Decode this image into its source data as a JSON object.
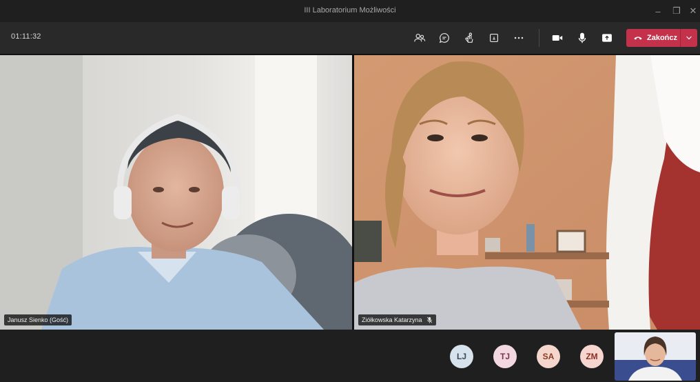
{
  "window": {
    "title": "III Laboratorium Możliwości",
    "controls": {
      "minimize_icon": "–",
      "maximize_icon": "❐",
      "close_icon": "✕"
    }
  },
  "toolbar": {
    "timer": "01:11:32",
    "icons": [
      "participants-icon",
      "chat-icon",
      "reactions-icon",
      "share-tray-icon",
      "more-actions-icon",
      "camera-icon",
      "microphone-icon",
      "share-screen-icon"
    ],
    "end_call_label": "Zakończ"
  },
  "participants": {
    "left": {
      "name": "Janusz Sienko (Gość)"
    },
    "right": {
      "name": "Ziółkowska Katarzyna",
      "muted": true
    }
  },
  "roster": [
    {
      "initials": "LJ",
      "bg": "#d7e3ec",
      "fg": "#3b4a58"
    },
    {
      "initials": "TJ",
      "bg": "#f3d7e1",
      "fg": "#7a3550"
    },
    {
      "initials": "SA",
      "bg": "#f5d6cc",
      "fg": "#8a3b22"
    },
    {
      "initials": "ZM",
      "bg": "#f7d6cf",
      "fg": "#8c2f21"
    }
  ],
  "colors": {
    "end_call": "#c4314b",
    "toolbar_bg": "#292929",
    "app_bg": "#1f1f1f"
  }
}
